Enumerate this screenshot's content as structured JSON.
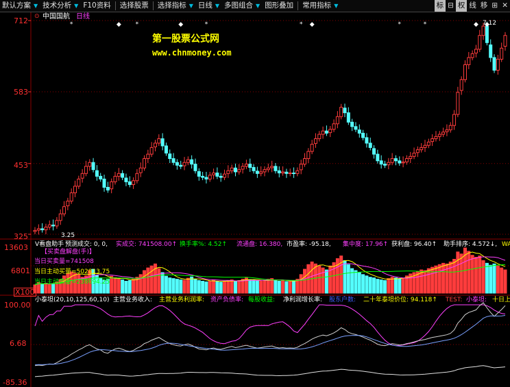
{
  "toolbar": {
    "items": [
      "默认方案",
      "技术分析",
      "F10资料",
      "选择股票",
      "选择指标",
      "日线",
      "多图组合",
      "图形叠加",
      "常用指标"
    ],
    "right_items": [
      "标",
      "⊟",
      "权",
      "线",
      "移",
      "⊞",
      "✕"
    ]
  },
  "main_chart": {
    "stock_name": "中国国航",
    "period": "日线",
    "y_ticks": [
      "712",
      "583",
      "453",
      "325"
    ],
    "high_label": "7.12",
    "low_label": "3.25",
    "watermark_title": "第一股票公式网",
    "watermark_url": "www.chnmoney.com"
  },
  "volume_panel": {
    "header": [
      {
        "text": "V看盘助手",
        "color": "#ffffff"
      },
      {
        "text": "预测成交: 0, 0,",
        "color": "#ffffff"
      },
      {
        "text": "实成交: 741508.00↑",
        "color": "#ff40ff"
      },
      {
        "text": "换手率%: 4.52↑",
        "color": "#00ff00"
      },
      {
        "text": "流通盘: 16.380,",
        "color": "#ff40ff"
      },
      {
        "text": "市盈率: -95.18,",
        "color": "#ffffff"
      },
      {
        "text": "集中度: 17.96↑",
        "color": "#ff40ff"
      },
      {
        "text": "获利盘: 96.40↑",
        "color": "#ffffff"
      },
      {
        "text": "助手排序: 4.572↓,",
        "color": "#ffffff"
      },
      {
        "text": "WA",
        "color": "#ffff00"
      }
    ],
    "sub_label": "【买卖盘解盘(手)】",
    "lines": [
      {
        "text": "当日买卖量=741508",
        "color": "#ff40ff"
      },
      {
        "text": "当日主动买量=502813.75",
        "color": "#ffff00"
      },
      {
        "text": "当日主动卖量=238694.25",
        "color": "#00ff00"
      }
    ],
    "y_ticks": [
      "13603",
      "6801",
      "X100"
    ]
  },
  "indicator_panel": {
    "header": [
      {
        "text": "小泰坦(20,10,125,60,10)",
        "color": "#ffffff"
      },
      {
        "text": "主营业务收入:",
        "color": "#ffffff"
      },
      {
        "text": "主营业务利润率:",
        "color": "#ffff00"
      },
      {
        "text": "资产负债率:",
        "color": "#ff40ff"
      },
      {
        "text": "每股收益:",
        "color": "#00ff00"
      },
      {
        "text": "净利润增长率:",
        "color": "#ffffff"
      },
      {
        "text": "股东户数:",
        "color": "#4060ff"
      },
      {
        "text": "二十年泰坦价位: 94.118↑",
        "color": "#ffff00"
      },
      {
        "text": "TEST:",
        "color": "#ff4040"
      },
      {
        "text": "小泰坦:",
        "color": "#ff40ff"
      },
      {
        "text": "十日上",
        "color": "#ffff00"
      }
    ],
    "y_ticks": [
      "100.00",
      "6.68",
      "-85.36"
    ]
  },
  "colors": {
    "up": "#ff3c3c",
    "down": "#54ffff",
    "grid": "#8b0000",
    "axis_text": "#ff3030",
    "magenta": "#ff40ff",
    "yellow": "#ffff00",
    "green": "#00ff00"
  },
  "chart_data": {
    "type": "candlestick",
    "price_range": [
      3.25,
      7.12
    ],
    "y_ticks_price": [
      3.25,
      4.53,
      5.83,
      7.12
    ],
    "high": 7.12,
    "low": 3.25,
    "closes": [
      3.32,
      3.35,
      3.33,
      3.38,
      3.42,
      3.4,
      3.5,
      3.62,
      3.75,
      3.85,
      4.0,
      4.12,
      4.25,
      4.35,
      4.48,
      4.55,
      4.42,
      4.3,
      4.25,
      4.1,
      4.05,
      4.2,
      4.3,
      4.35,
      4.28,
      4.2,
      4.15,
      4.22,
      4.35,
      4.45,
      4.62,
      4.7,
      4.82,
      4.9,
      4.98,
      4.85,
      4.72,
      4.62,
      4.55,
      4.5,
      4.48,
      4.55,
      4.6,
      4.52,
      4.4,
      4.3,
      4.28,
      4.25,
      4.32,
      4.36,
      4.3,
      4.28,
      4.34,
      4.4,
      4.45,
      4.38,
      4.42,
      4.48,
      4.52,
      4.46,
      4.4,
      4.35,
      4.38,
      4.42,
      4.45,
      4.48,
      4.4,
      4.36,
      4.38,
      4.35,
      4.36,
      4.35,
      4.4,
      4.52,
      4.62,
      4.75,
      4.88,
      4.98,
      5.06,
      5.12,
      5.08,
      5.15,
      5.25,
      5.38,
      5.55,
      5.45,
      5.28,
      5.2,
      5.15,
      5.08,
      5.0,
      4.9,
      4.82,
      4.7,
      4.58,
      4.52,
      4.5,
      4.55,
      4.62,
      4.58,
      4.54,
      4.56,
      4.62,
      4.66,
      4.72,
      4.78,
      4.82,
      4.86,
      4.92,
      4.98,
      5.02,
      5.06,
      5.1,
      5.14,
      5.22,
      5.42,
      5.82,
      6.05,
      6.32,
      6.45,
      6.52,
      6.6,
      6.85,
      7.02,
      6.72,
      6.45,
      6.22,
      6.42,
      6.62,
      6.85
    ],
    "volumes": [
      2500,
      3200,
      2800,
      3000,
      2600,
      2900,
      3400,
      4100,
      5200,
      5800,
      6400,
      6000,
      5600,
      4800,
      5200,
      6800,
      7200,
      5400,
      4600,
      3900,
      4200,
      5100,
      4700,
      4300,
      4000,
      3600,
      3800,
      4200,
      4800,
      5600,
      6800,
      7600,
      8200,
      8800,
      7400,
      6200,
      5100,
      4600,
      4400,
      4200,
      4000,
      3900,
      4500,
      4900,
      4200,
      3800,
      3600,
      3400,
      3700,
      3900,
      3500,
      3300,
      3600,
      3800,
      4000,
      3600,
      3800,
      4200,
      4600,
      4100,
      3900,
      3700,
      3600,
      3800,
      4200,
      4400,
      3900,
      3600,
      3800,
      3500,
      3600,
      3700,
      4200,
      5600,
      7200,
      8600,
      9400,
      8800,
      8200,
      7600,
      7000,
      8200,
      9200,
      10400,
      11200,
      9800,
      8600,
      7400,
      6800,
      6200,
      5600,
      5200,
      4800,
      4600,
      4200,
      4000,
      3800,
      4400,
      4800,
      4600,
      4400,
      4500,
      5200,
      5800,
      6200,
      6600,
      7000,
      6800,
      7400,
      7800,
      8200,
      8600,
      9000,
      8800,
      9400,
      10200,
      12400,
      11800,
      13603,
      12600,
      11400,
      10800,
      11200,
      9800,
      9000,
      8400,
      8800,
      8200,
      7600,
      7000
    ]
  }
}
